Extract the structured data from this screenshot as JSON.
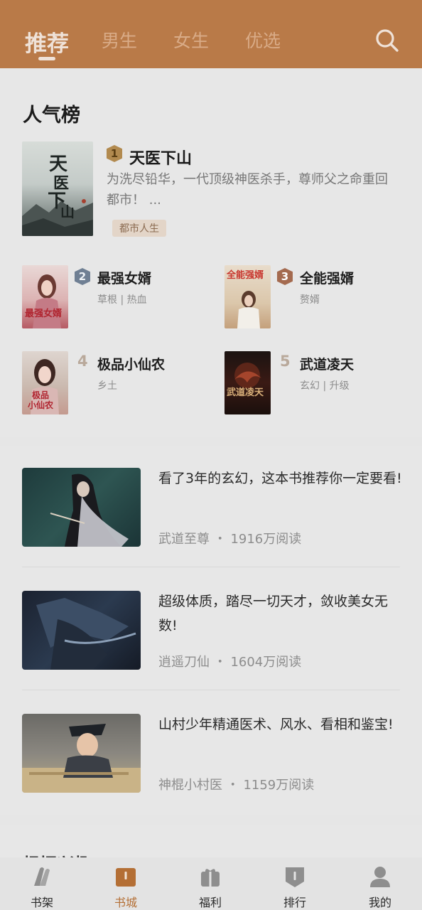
{
  "header": {
    "tabs": [
      {
        "label": "推荐",
        "active": true
      },
      {
        "label": "男生",
        "active": false
      },
      {
        "label": "女生",
        "active": false
      },
      {
        "label": "优选",
        "active": false
      }
    ],
    "search_icon": "search-icon"
  },
  "ranking": {
    "title": "人气榜",
    "top": {
      "rank": "1",
      "title": "天医下山",
      "description": "为洗尽铅华，一代顶级神医杀手，尊师父之命重回都市！ ...",
      "tag": "都市人生",
      "cover_text": "天医下山"
    },
    "items": [
      {
        "rank": "2",
        "title": "最强女婿",
        "meta": "草根 | 热血",
        "cover_text": "最强女婿"
      },
      {
        "rank": "3",
        "title": "全能强婿",
        "meta": "赘婿",
        "cover_text": "全能强婿"
      },
      {
        "rank": "4",
        "title": "极品小仙农",
        "meta": "乡土",
        "cover_text": "极品小仙农"
      },
      {
        "rank": "5",
        "title": "武道凌天",
        "meta": "玄幻 | 升级",
        "cover_text": "武道凌天"
      }
    ]
  },
  "recommendations": [
    {
      "title": "看了3年的玄幻，这本书推荐你一定要看!",
      "book": "武道至尊",
      "reads": "1916万阅读"
    },
    {
      "title": "超级体质，踏尽一切天才，敛收美女无数!",
      "book": "逍遥刀仙",
      "reads": "1604万阅读"
    },
    {
      "title": "山村少年精通医术、风水、看相和鉴宝!",
      "book": "神棍小村医",
      "reads": "1159万阅读"
    }
  ],
  "next_section": {
    "title": "根据兴趣"
  },
  "bottom_nav": [
    {
      "label": "书架",
      "icon": "bookshelf-icon",
      "active": false
    },
    {
      "label": "书城",
      "icon": "bookstore-icon",
      "active": true
    },
    {
      "label": "福利",
      "icon": "gift-icon",
      "active": false
    },
    {
      "label": "排行",
      "icon": "ranking-icon",
      "active": false
    },
    {
      "label": "我的",
      "icon": "profile-icon",
      "active": false
    }
  ],
  "colors": {
    "header": "#b97a48",
    "accent": "#b46f35"
  }
}
